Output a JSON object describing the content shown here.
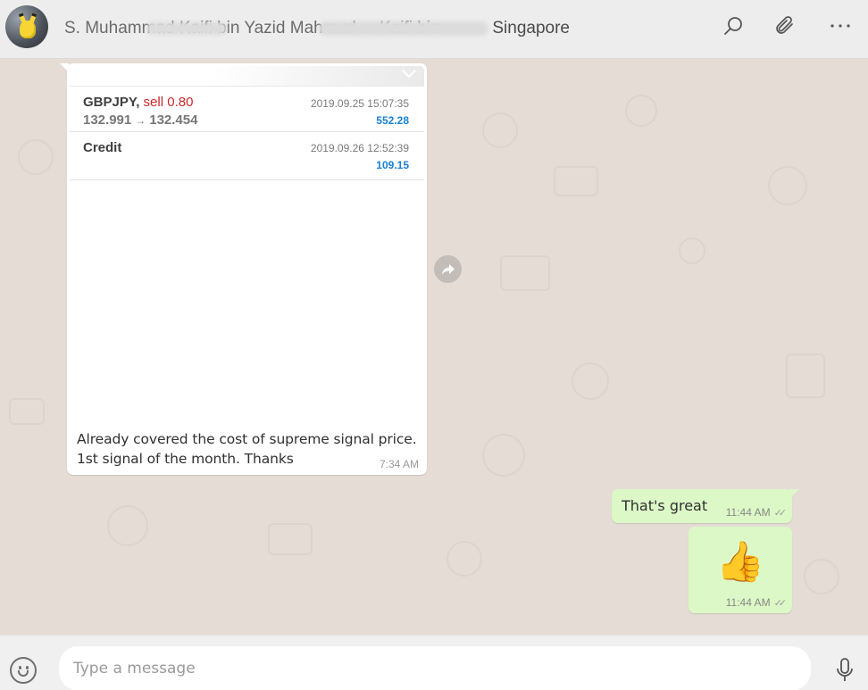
{
  "header": {
    "contact_name_masked": "S. Muhammad Kaifi bin Yazid Mahmud ... Kaifi bin",
    "contact_name_visible": "Singapore",
    "icons": [
      "search-icon",
      "paperclip-icon",
      "more-icon"
    ]
  },
  "incoming": {
    "trades": [
      {
        "symbol": "GBPJPY,",
        "action": "sell 0.80",
        "open_price": "132.991",
        "arrow": "→",
        "close_price": "132.454",
        "timestamp": "2019.09.25 15:07:35",
        "profit": "552.28"
      },
      {
        "label": "Credit",
        "timestamp": "2019.09.26 12:52:39",
        "amount": "109.15"
      }
    ],
    "caption_line1": "Already covered the cost of supreme signal price.",
    "caption_line2": "1st signal of the month. Thanks",
    "time": "7:34 AM"
  },
  "outgoing": [
    {
      "text": "That's great",
      "time": "11:44 AM"
    },
    {
      "emoji": "👍",
      "time": "11:44 AM"
    }
  ],
  "compose": {
    "placeholder": "Type a message"
  },
  "colors": {
    "header_bg": "#ededed",
    "wallpaper": "#e5ddd5",
    "outgoing_bubble": "#dcf8c6",
    "incoming_bubble": "#ffffff",
    "sell_red": "#c9282a",
    "profit_blue": "#1a7fd0"
  }
}
